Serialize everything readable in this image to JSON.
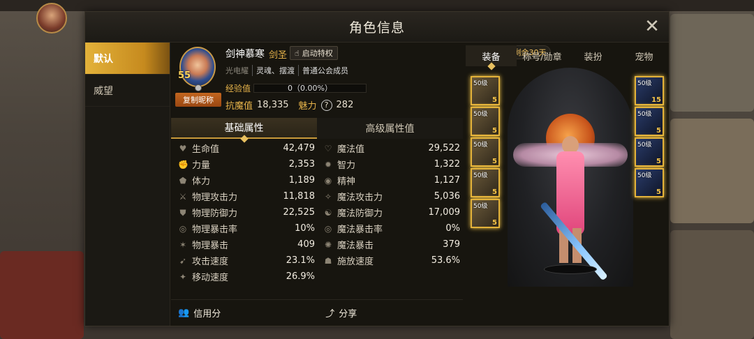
{
  "window": {
    "title": "角色信息",
    "close_icon": "close-icon"
  },
  "nav": {
    "items": [
      {
        "label": "默认",
        "active": true
      },
      {
        "label": "威望",
        "active": false
      }
    ]
  },
  "profile": {
    "name": "剑神慕寒",
    "class": "剑圣",
    "level": "55",
    "privilege_label": "启动特权",
    "copy_nickname": "复制昵称",
    "tags": [
      "光电耀",
      "灵魂、摆渡",
      "普通公会成员"
    ],
    "exp_label": "经验值",
    "exp_value": "0（0.00%）",
    "exp_fraction": 0,
    "anti_magic_label": "抗魔值",
    "anti_magic_value": "18,335",
    "charm_label": "魅力",
    "charm_value": "282",
    "remaining": "剩余30天"
  },
  "attr_tabs": [
    {
      "label": "基础属性",
      "active": true
    },
    {
      "label": "高级属性值",
      "active": false
    }
  ],
  "stats_left": [
    {
      "icon": "heart-icon",
      "name": "生命值",
      "value": "42,479"
    },
    {
      "icon": "strength-icon",
      "name": "力量",
      "value": "2,353"
    },
    {
      "icon": "stamina-icon",
      "name": "体力",
      "value": "1,189"
    },
    {
      "icon": "sword-icon",
      "name": "物理攻击力",
      "value": "11,818"
    },
    {
      "icon": "shield-icon",
      "name": "物理防御力",
      "value": "22,525"
    },
    {
      "icon": "crit-rate-icon",
      "name": "物理暴击率",
      "value": "10%"
    },
    {
      "icon": "crit-icon",
      "name": "物理暴击",
      "value": "409"
    },
    {
      "icon": "attack-speed-icon",
      "name": "攻击速度",
      "value": "23.1%"
    },
    {
      "icon": "move-speed-icon",
      "name": "移动速度",
      "value": "26.9%"
    }
  ],
  "stats_right": [
    {
      "icon": "mana-icon",
      "name": "魔法值",
      "value": "29,522"
    },
    {
      "icon": "intellect-icon",
      "name": "智力",
      "value": "1,322"
    },
    {
      "icon": "spirit-icon",
      "name": "精神",
      "value": "1,127"
    },
    {
      "icon": "magic-attack-icon",
      "name": "魔法攻击力",
      "value": "5,036"
    },
    {
      "icon": "magic-defense-icon",
      "name": "魔法防御力",
      "value": "17,009"
    },
    {
      "icon": "magic-crit-rate-icon",
      "name": "魔法暴击率",
      "value": "0%"
    },
    {
      "icon": "magic-crit-icon",
      "name": "魔法暴击",
      "value": "379"
    },
    {
      "icon": "cast-speed-icon",
      "name": "施放速度",
      "value": "53.6%"
    }
  ],
  "footer": {
    "credit": "信用分",
    "share": "分享"
  },
  "right_tabs": [
    {
      "label": "装备",
      "active": true
    },
    {
      "label": "称号/勋章",
      "active": false
    },
    {
      "label": "装扮",
      "active": false
    },
    {
      "label": "宠物",
      "active": false
    }
  ],
  "equipment_left": [
    {
      "level": "50级",
      "refine": "5"
    },
    {
      "level": "50级",
      "refine": "5"
    },
    {
      "level": "50级",
      "refine": "5"
    },
    {
      "level": "50级",
      "refine": "5"
    },
    {
      "level": "50级",
      "refine": "5"
    }
  ],
  "equipment_right": [
    {
      "level": "50级",
      "refine": "15"
    },
    {
      "level": "50级",
      "refine": "5"
    },
    {
      "level": "50级",
      "refine": "5"
    },
    {
      "level": "50级",
      "refine": "5"
    }
  ]
}
